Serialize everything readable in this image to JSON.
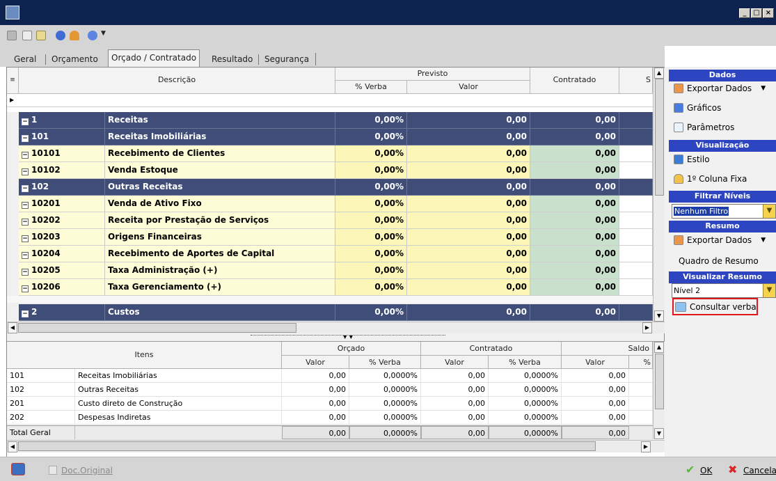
{
  "toolbar": {
    "icons": [
      "cut-icon",
      "copy-icon",
      "paste-icon",
      "info-icon",
      "user-icon",
      "help-icon",
      "chevron-down-icon"
    ]
  },
  "tabs": [
    "Geral",
    "Orçamento",
    "Orçado / Contratado",
    "Resultado",
    "Segurança"
  ],
  "grid": {
    "headers": {
      "descricao": "Descrição",
      "previsto": "Previsto",
      "pct_verba": "% Verba",
      "valor": "Valor",
      "contratado": "Contratado",
      "saldo_partial": "S"
    },
    "rows": [
      {
        "code": "1",
        "desc": "Receitas",
        "pct": "0,00%",
        "valor": "0,00",
        "contratado": "0,00",
        "style": "dark"
      },
      {
        "code": "101",
        "desc": "Receitas Imobiliárias",
        "pct": "0,00%",
        "valor": "0,00",
        "contratado": "0,00",
        "style": "dark"
      },
      {
        "code": "10101",
        "desc": "Recebimento de Clientes",
        "pct": "0,00%",
        "valor": "0,00",
        "contratado": "0,00",
        "style": "light"
      },
      {
        "code": "10102",
        "desc": "Venda Estoque",
        "pct": "0,00%",
        "valor": "0,00",
        "contratado": "0,00",
        "style": "light"
      },
      {
        "code": "102",
        "desc": "Outras Receitas",
        "pct": "0,00%",
        "valor": "0,00",
        "contratado": "0,00",
        "style": "dark"
      },
      {
        "code": "10201",
        "desc": "Venda de Ativo Fixo",
        "pct": "0,00%",
        "valor": "0,00",
        "contratado": "0,00",
        "style": "light"
      },
      {
        "code": "10202",
        "desc": "Receita por Prestação de Serviços",
        "pct": "0,00%",
        "valor": "0,00",
        "contratado": "0,00",
        "style": "light"
      },
      {
        "code": "10203",
        "desc": "Origens Financeiras",
        "pct": "0,00%",
        "valor": "0,00",
        "contratado": "0,00",
        "style": "light"
      },
      {
        "code": "10204",
        "desc": "Recebimento de Aportes de Capital",
        "pct": "0,00%",
        "valor": "0,00",
        "contratado": "0,00",
        "style": "light"
      },
      {
        "code": "10205",
        "desc": "Taxa Administração (+)",
        "pct": "0,00%",
        "valor": "0,00",
        "contratado": "0,00",
        "style": "light"
      },
      {
        "code": "10206",
        "desc": "Taxa Gerenciamento (+)",
        "pct": "0,00%",
        "valor": "0,00",
        "contratado": "0,00",
        "style": "light"
      }
    ],
    "last_row": {
      "code": "2",
      "desc": "Custos",
      "pct": "0,00%",
      "valor": "0,00",
      "contratado": "0,00"
    }
  },
  "summary": {
    "headers": {
      "itens": "Itens",
      "orcado": "Orçado",
      "contratado": "Contratado",
      "saldo": "Saldo",
      "valor": "Valor",
      "pct_verba": "% Verba",
      "pct_partial": "%"
    },
    "rows": [
      {
        "code": "101",
        "desc": "Receitas Imobiliárias",
        "o_valor": "0,00",
        "o_pct": "0,0000%",
        "c_valor": "0,00",
        "c_pct": "0,0000%",
        "s_valor": "0,00"
      },
      {
        "code": "102",
        "desc": "Outras Receitas",
        "o_valor": "0,00",
        "o_pct": "0,0000%",
        "c_valor": "0,00",
        "c_pct": "0,0000%",
        "s_valor": "0,00"
      },
      {
        "code": "201",
        "desc": "Custo direto de Construção",
        "o_valor": "0,00",
        "o_pct": "0,0000%",
        "c_valor": "0,00",
        "c_pct": "0,0000%",
        "s_valor": "0,00"
      },
      {
        "code": "202",
        "desc": "Despesas Indiretas",
        "o_valor": "0,00",
        "o_pct": "0,0000%",
        "c_valor": "0,00",
        "c_pct": "0,0000%",
        "s_valor": "0,00"
      }
    ],
    "total": {
      "label": "Total Geral",
      "o_valor": "0,00",
      "o_pct": "0,0000%",
      "c_valor": "0,00",
      "c_pct": "0,0000%",
      "s_valor": "0,00"
    }
  },
  "sidebar": {
    "dados_header": "Dados",
    "exportar_dados": "Exportar Dados",
    "graficos": "Gráficos",
    "parametros": "Parâmetros",
    "visualizacao_header": "Visualização",
    "estilo": "Estilo",
    "coluna_fixa": "1º Coluna Fixa",
    "filtrar_niveis_header": "Filtrar Níveis",
    "filtro_value": "Nenhum Filtro",
    "resumo_header": "Resumo",
    "exportar_dados_2": "Exportar Dados",
    "quadro_resumo": "Quadro de Resumo",
    "visualizar_resumo_header": "Visualizar Resumo",
    "nivel_value": "Nível 2",
    "consultar_verba": "Consultar verba"
  },
  "statusbar": {
    "doc_original": "Doc.Original",
    "ok": "OK",
    "cancela": "Cancela"
  },
  "colors": {
    "title_bg": "#0f2350",
    "section_header": "#2d45c0",
    "dark_row": "#3f4d78",
    "light_row": "#fefcd6",
    "green_cell": "#c8e0cc",
    "highlight_border": "#e0161d"
  }
}
